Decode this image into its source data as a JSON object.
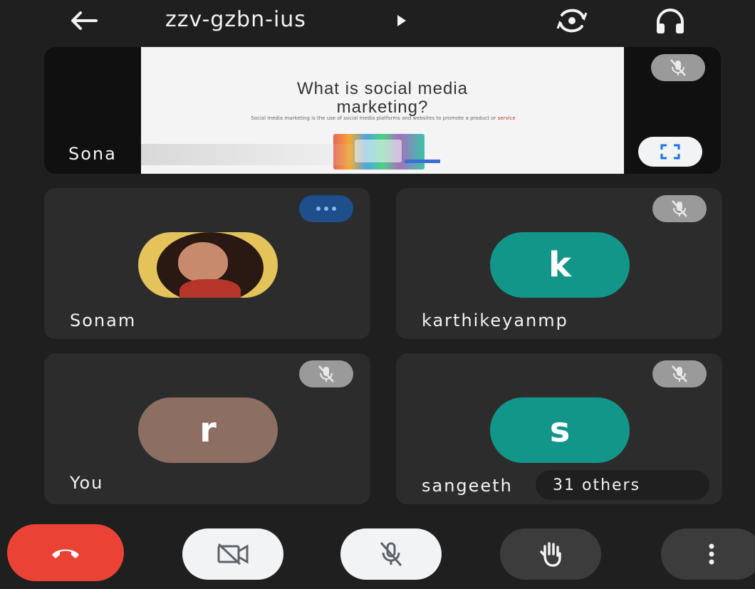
{
  "header": {
    "meeting_code": "zzv-gzbn-ius",
    "icons": {
      "back": "arrow-left-icon",
      "caret": "play-arrow-icon",
      "switch_camera": "switch-camera-icon",
      "audio": "headphones-icon"
    }
  },
  "presentation": {
    "presenter_label": "Sona",
    "slide": {
      "title_line1": "What is social media",
      "title_line2": "marketing?",
      "body": "Social media marketing is the use of social media platforms and websites to promote a product or",
      "body_highlight": "service"
    },
    "icons": {
      "mute": "mic-off-icon",
      "fullscreen": "fullscreen-icon"
    }
  },
  "participants": [
    {
      "name": "Sonam",
      "avatar_type": "photo",
      "status": "speaking"
    },
    {
      "name": "karthikeyanmp",
      "avatar_initial": "k",
      "avatar_color": "#13968a",
      "status": "muted"
    },
    {
      "name": "You",
      "avatar_initial": "r",
      "avatar_color": "#8d6e63",
      "status": "muted"
    },
    {
      "name": "sangeeth",
      "avatar_initial": "s",
      "avatar_color": "#13968a",
      "status": "muted"
    }
  ],
  "others": {
    "label": "31 others"
  },
  "controls": [
    {
      "id": "end-call",
      "icon": "call-end-icon",
      "color": "#ea4335"
    },
    {
      "id": "camera",
      "icon": "videocam-off-icon",
      "color": "#f1f3f4"
    },
    {
      "id": "mic",
      "icon": "mic-off-icon",
      "color": "#f1f3f4"
    },
    {
      "id": "raise-hand",
      "icon": "hand-icon",
      "color": "#3c3c3c"
    },
    {
      "id": "more",
      "icon": "more-vertical-icon",
      "color": "#3c3c3c"
    }
  ]
}
